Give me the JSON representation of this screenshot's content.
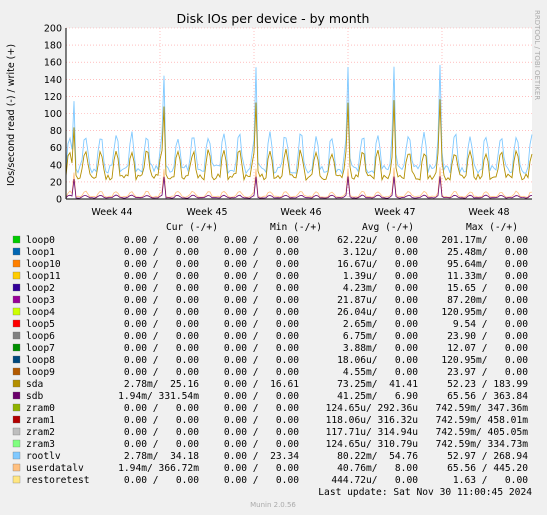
{
  "chart_data": {
    "type": "line",
    "title": "Disk IOs per device - by month",
    "ylabel": "IOs/second read (-) / write (+)",
    "ylim": [
      0,
      200
    ],
    "yticks": [
      "0",
      "20",
      "40",
      "60",
      "80",
      "100",
      "120",
      "140",
      "160",
      "180",
      "200"
    ],
    "xticks": [
      "Week 44",
      "Week 45",
      "Week 46",
      "Week 47",
      "Week 48"
    ],
    "side_label": "RRDTOOL / TOBI OETIKER",
    "footer": "Munin 2.0.56",
    "last_update": "Last update: Sat Nov 30 11:00:45 2024",
    "grid": true,
    "legend_headers": [
      "Cur (-/+)",
      "Min (-/+)",
      "Avg (-/+)",
      "Max (-/+)"
    ],
    "series": [
      {
        "name": "loop0",
        "color": "#00cc00",
        "cur": "0.00 /   0.00",
        "min": "0.00 /   0.00",
        "avg": "62.22u/   0.00",
        "max": "201.17m/   0.00"
      },
      {
        "name": "loop1",
        "color": "#0066b3",
        "cur": "0.00 /   0.00",
        "min": "0.00 /   0.00",
        "avg": "3.12u/   0.00",
        "max": "25.48m/   0.00"
      },
      {
        "name": "loop10",
        "color": "#ff8000",
        "cur": "0.00 /   0.00",
        "min": "0.00 /   0.00",
        "avg": "16.67u/   0.00",
        "max": "95.64m/   0.00"
      },
      {
        "name": "loop11",
        "color": "#ffcc00",
        "cur": "0.00 /   0.00",
        "min": "0.00 /   0.00",
        "avg": "1.39u/   0.00",
        "max": "11.33m/   0.00"
      },
      {
        "name": "loop2",
        "color": "#330099",
        "cur": "0.00 /   0.00",
        "min": "0.00 /   0.00",
        "avg": "4.23m/   0.00",
        "max": "15.65 /   0.00"
      },
      {
        "name": "loop3",
        "color": "#990099",
        "cur": "0.00 /   0.00",
        "min": "0.00 /   0.00",
        "avg": "21.87u/   0.00",
        "max": "87.20m/   0.00"
      },
      {
        "name": "loop4",
        "color": "#ccff00",
        "cur": "0.00 /   0.00",
        "min": "0.00 /   0.00",
        "avg": "26.04u/   0.00",
        "max": "120.95m/   0.00"
      },
      {
        "name": "loop5",
        "color": "#ff0000",
        "cur": "0.00 /   0.00",
        "min": "0.00 /   0.00",
        "avg": "2.65m/   0.00",
        "max": "9.54 /   0.00"
      },
      {
        "name": "loop6",
        "color": "#808080",
        "cur": "0.00 /   0.00",
        "min": "0.00 /   0.00",
        "avg": "6.75m/   0.00",
        "max": "23.90 /   0.00"
      },
      {
        "name": "loop7",
        "color": "#008f00",
        "cur": "0.00 /   0.00",
        "min": "0.00 /   0.00",
        "avg": "3.88m/   0.00",
        "max": "12.07 /   0.00"
      },
      {
        "name": "loop8",
        "color": "#00487d",
        "cur": "0.00 /   0.00",
        "min": "0.00 /   0.00",
        "avg": "18.06u/   0.00",
        "max": "120.95m/   0.00"
      },
      {
        "name": "loop9",
        "color": "#b35a00",
        "cur": "0.00 /   0.00",
        "min": "0.00 /   0.00",
        "avg": "4.55m/   0.00",
        "max": "23.97 /   0.00"
      },
      {
        "name": "sda",
        "color": "#b38f00",
        "cur": "2.78m/  25.16",
        "min": "0.00 /  16.61",
        "avg": "73.25m/  41.41",
        "max": "52.23 / 183.99"
      },
      {
        "name": "sdb",
        "color": "#6b006b",
        "cur": "1.94m/ 331.54m",
        "min": "0.00 /   0.00",
        "avg": "41.25m/   6.90",
        "max": "65.56 / 363.84"
      },
      {
        "name": "zram0",
        "color": "#8fb300",
        "cur": "0.00 /   0.00",
        "min": "0.00 /   0.00",
        "avg": "124.65u/ 292.36u",
        "max": "742.59m/ 347.36m"
      },
      {
        "name": "zram1",
        "color": "#b30000",
        "cur": "0.00 /   0.00",
        "min": "0.00 /   0.00",
        "avg": "118.06u/ 316.32u",
        "max": "742.59m/ 458.01m"
      },
      {
        "name": "zram2",
        "color": "#bebebe",
        "cur": "0.00 /   0.00",
        "min": "0.00 /   0.00",
        "avg": "117.71u/ 314.94u",
        "max": "742.59m/ 405.05m"
      },
      {
        "name": "zram3",
        "color": "#80ff80",
        "cur": "0.00 /   0.00",
        "min": "0.00 /   0.00",
        "avg": "124.65u/ 310.79u",
        "max": "742.59m/ 334.73m"
      },
      {
        "name": "rootlv",
        "color": "#80c9ff",
        "cur": "2.78m/  34.18",
        "min": "0.00 /  23.34",
        "avg": "80.22m/  54.76",
        "max": "52.97 / 268.94"
      },
      {
        "name": "userdatalv",
        "color": "#ffc080",
        "cur": "1.94m/ 366.72m",
        "min": "0.00 /   0.00",
        "avg": "40.76m/   8.00",
        "max": "65.56 / 445.20"
      },
      {
        "name": "restoretest",
        "color": "#ffe680",
        "cur": "0.00 /   0.00",
        "min": "0.00 /   0.00",
        "avg": "444.72u/   0.00",
        "max": "1.63 /   0.00"
      }
    ]
  }
}
